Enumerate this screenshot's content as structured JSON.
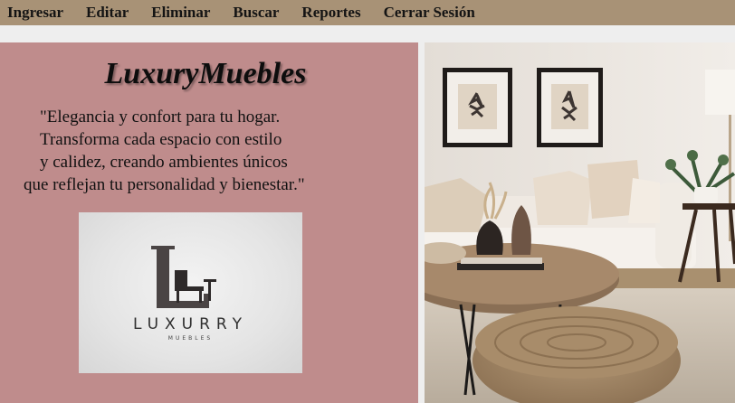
{
  "menu": {
    "items": [
      "Ingresar",
      "Editar",
      "Eliminar",
      "Buscar",
      "Reportes",
      "Cerrar Sesión"
    ]
  },
  "brand": {
    "title": "LuxuryMuebles"
  },
  "slogan": {
    "lines": [
      "\"Elegancia y confort para tu hogar.",
      "Transforma cada espacio con estilo",
      "y calidez, creando ambientes únicos",
      "que reflejan tu personalidad y bienestar.\""
    ]
  },
  "logo": {
    "word": "LUXURRY",
    "sub": "MUEBLES",
    "icon": "chair-letter-l-logo"
  },
  "photo": {
    "subject": "living-room-photo"
  },
  "colors": {
    "menubar": "#a89276",
    "panel": "#bf8c8c",
    "page": "#eeeeee"
  }
}
